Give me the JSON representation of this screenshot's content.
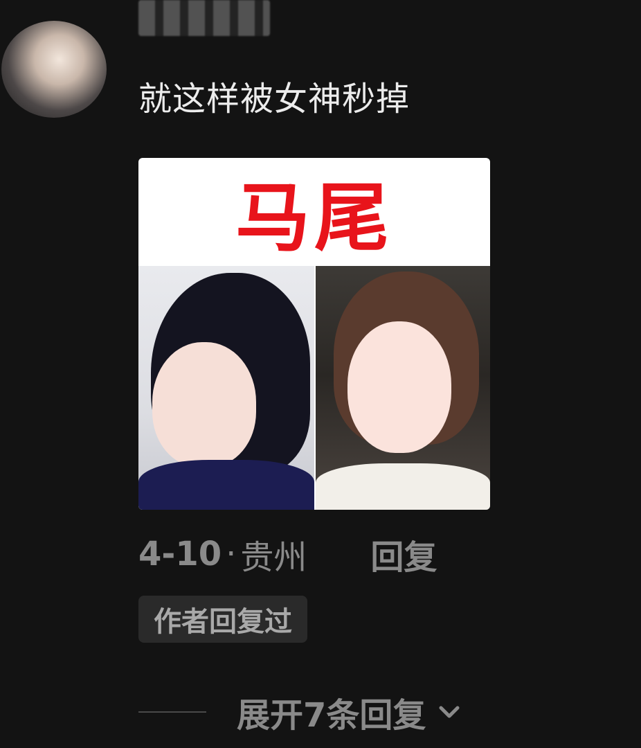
{
  "comment": {
    "text": "就这样被女神秒掉",
    "image_caption": "马尾",
    "date": "4-10",
    "separator": "·",
    "location": "贵州",
    "reply_label": "回复",
    "author_badge": "作者回复过"
  },
  "replies": {
    "expand_label": "展开7条回复",
    "chevron_icon": "chevron-down-icon"
  },
  "colors": {
    "background": "#131313",
    "caption_red": "#e8141b",
    "meta_gray": "#8a8a8a"
  }
}
